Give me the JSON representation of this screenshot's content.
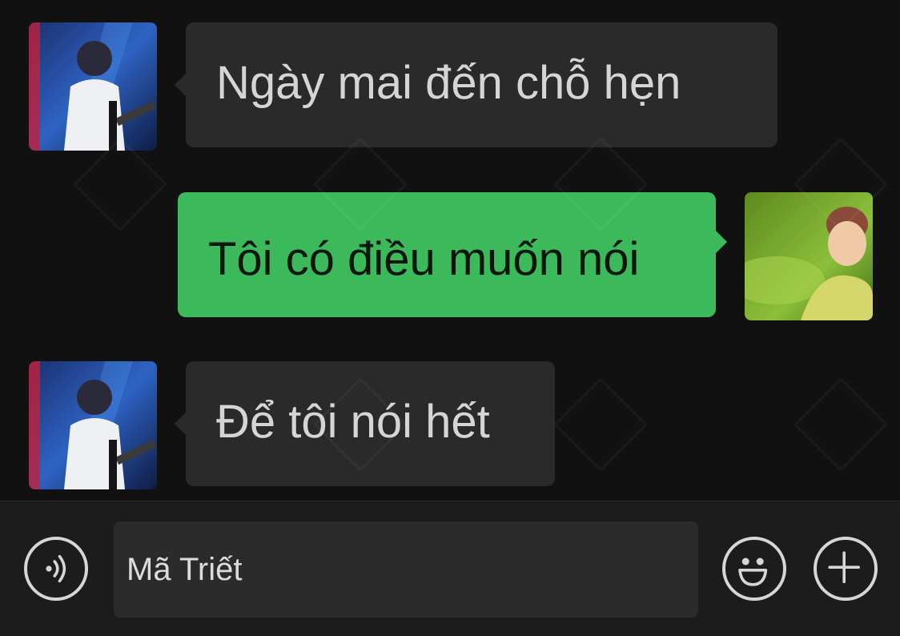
{
  "messages": [
    {
      "side": "incoming",
      "text": "Ngày mai đến chỗ hẹn"
    },
    {
      "side": "outgoing",
      "text": "Tôi có điều muốn nói"
    },
    {
      "side": "incoming",
      "text": "Để tôi nói hết"
    }
  ],
  "input_bar": {
    "value": "Mã Triết",
    "voice_icon": "voice-icon",
    "emoji_icon": "emoji-icon",
    "add_icon": "plus-icon"
  },
  "colors": {
    "background": "#111111",
    "incoming_bubble": "#2a2a2a",
    "outgoing_bubble": "#3cb95a",
    "input_bar": "#1c1c1c"
  }
}
